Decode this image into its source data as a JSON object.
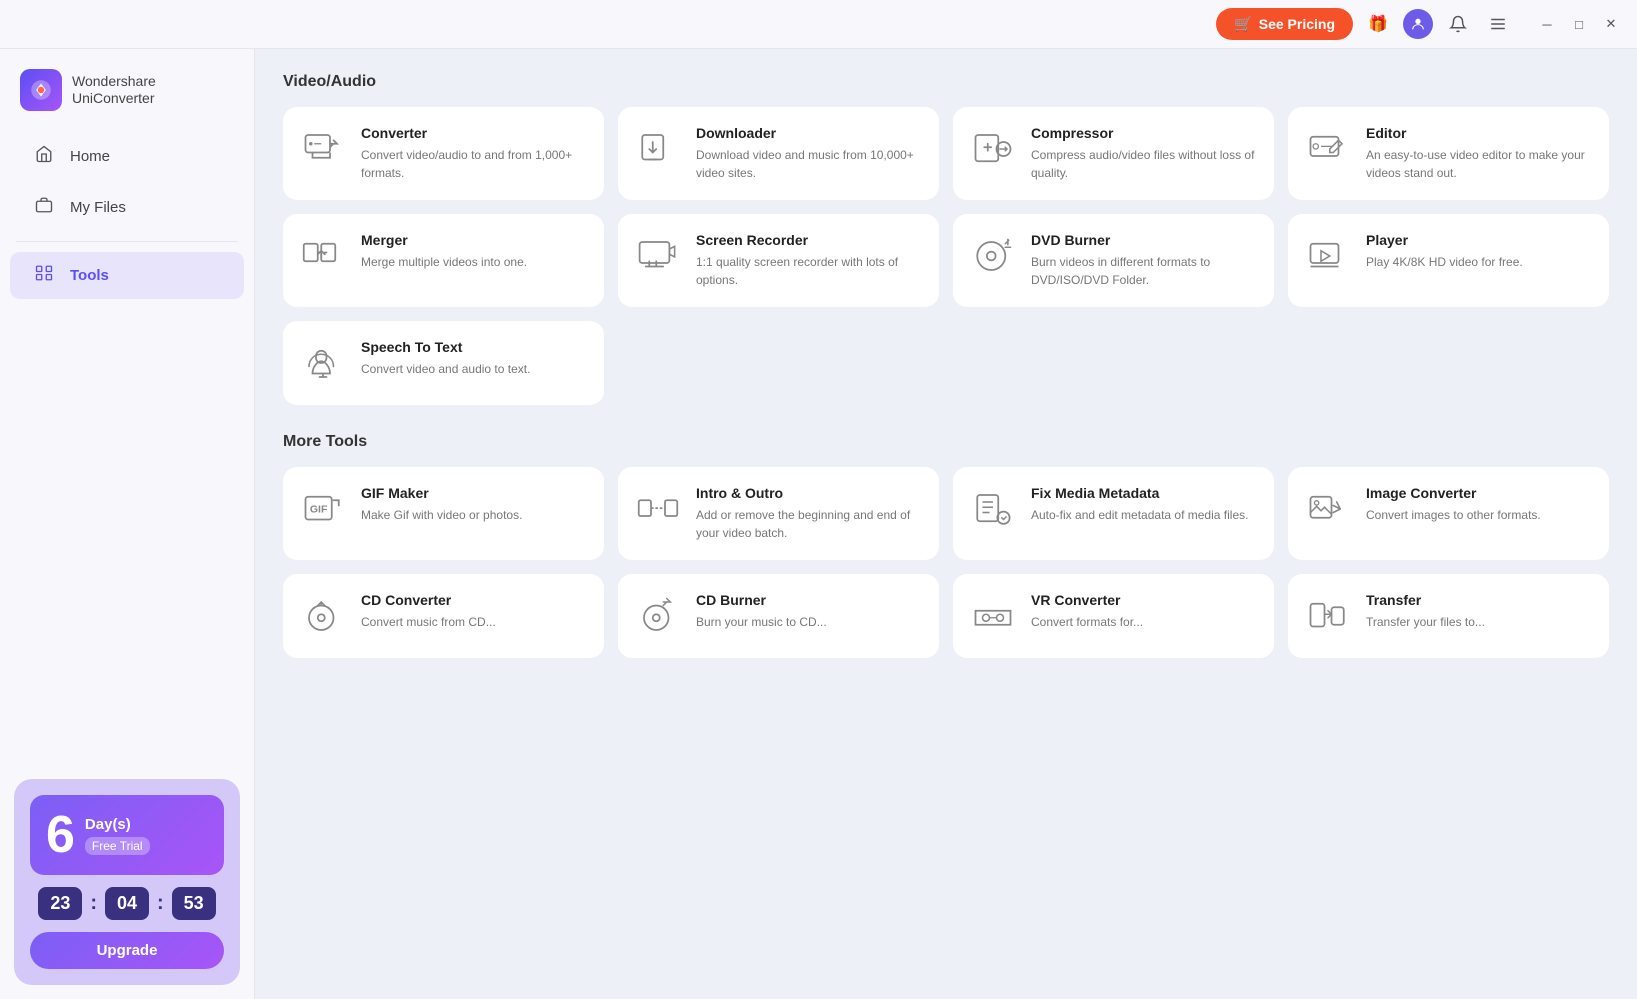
{
  "titlebar": {
    "see_pricing_label": "See Pricing",
    "cart_icon": "🛒",
    "gift_icon": "🎁",
    "user_icon": "👤",
    "notification_icon": "🔔",
    "menu_icon": "☰",
    "minimize_icon": "─",
    "maximize_icon": "□",
    "close_icon": "✕"
  },
  "sidebar": {
    "logo_line1": "Wondershare",
    "logo_line2": "UniConverter",
    "nav_items": [
      {
        "id": "home",
        "label": "Home",
        "icon": "⌂",
        "active": false
      },
      {
        "id": "my-files",
        "label": "My Files",
        "icon": "📁",
        "active": false
      },
      {
        "id": "tools",
        "label": "Tools",
        "icon": "🧰",
        "active": true
      }
    ],
    "trial": {
      "days_number": "6",
      "days_label": "Day(s)",
      "free_trial": "Free Trial",
      "timer_h": "23",
      "timer_m": "04",
      "timer_s": "53",
      "upgrade_label": "Upgrade"
    }
  },
  "main": {
    "video_audio_section": "Video/Audio",
    "more_tools_section": "More Tools",
    "video_audio_tools": [
      {
        "id": "converter",
        "name": "Converter",
        "desc": "Convert video/audio to and from 1,000+ formats."
      },
      {
        "id": "downloader",
        "name": "Downloader",
        "desc": "Download video and music from 10,000+ video sites."
      },
      {
        "id": "compressor",
        "name": "Compressor",
        "desc": "Compress audio/video files without loss of quality."
      },
      {
        "id": "editor",
        "name": "Editor",
        "desc": "An easy-to-use video editor to make your videos stand out."
      },
      {
        "id": "merger",
        "name": "Merger",
        "desc": "Merge multiple videos into one."
      },
      {
        "id": "screen-recorder",
        "name": "Screen Recorder",
        "desc": "1:1 quality screen recorder with lots of options."
      },
      {
        "id": "dvd-burner",
        "name": "DVD Burner",
        "desc": "Burn videos in different formats to DVD/ISO/DVD Folder."
      },
      {
        "id": "player",
        "name": "Player",
        "desc": "Play 4K/8K HD video for free."
      },
      {
        "id": "speech-to-text",
        "name": "Speech To Text",
        "desc": "Convert video and audio to text."
      }
    ],
    "more_tools": [
      {
        "id": "gif-maker",
        "name": "GIF Maker",
        "desc": "Make Gif with video or photos."
      },
      {
        "id": "intro-outro",
        "name": "Intro & Outro",
        "desc": "Add or remove the beginning and end of your video batch."
      },
      {
        "id": "fix-media-metadata",
        "name": "Fix Media Metadata",
        "desc": "Auto-fix and edit metadata of media files."
      },
      {
        "id": "image-converter",
        "name": "Image Converter",
        "desc": "Convert images to other formats."
      },
      {
        "id": "cd-converter",
        "name": "CD Converter",
        "desc": "Convert music from CD..."
      },
      {
        "id": "cd-burner",
        "name": "CD Burner",
        "desc": "Burn your music to CD..."
      },
      {
        "id": "vr-converter",
        "name": "VR Converter",
        "desc": "Convert formats for..."
      },
      {
        "id": "transfer",
        "name": "Transfer",
        "desc": "Transfer your files to..."
      }
    ]
  }
}
